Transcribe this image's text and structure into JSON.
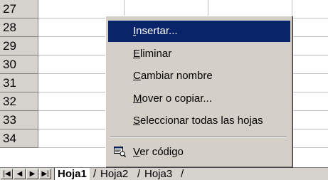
{
  "grid": {
    "rows": [
      "27",
      "28",
      "29",
      "30",
      "31",
      "32",
      "33",
      "34"
    ]
  },
  "context_menu": {
    "items": [
      {
        "label": "Insertar...",
        "accel": "I",
        "selected": true
      },
      {
        "label": "Eliminar",
        "accel": "E",
        "selected": false
      },
      {
        "label": "Cambiar nombre",
        "accel": "C",
        "selected": false
      },
      {
        "label": "Mover o copiar...",
        "accel": "M",
        "selected": false
      },
      {
        "label": "Seleccionar todas las hojas",
        "accel": "S",
        "selected": false
      }
    ],
    "code_item": {
      "label": "Ver código",
      "accel": "V",
      "icon": "view-code-icon"
    }
  },
  "sheet_tabs": {
    "tabs": [
      "Hoja1",
      "Hoja2",
      "Hoja3"
    ],
    "active": "Hoja1"
  },
  "colors": {
    "selection": "#0a246a",
    "menu_bg": "#d4d0c8",
    "header_bg": "#d6d3ce"
  }
}
